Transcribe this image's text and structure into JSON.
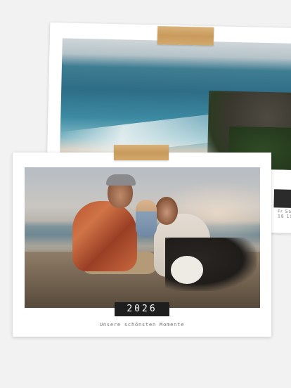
{
  "front": {
    "year": "2026",
    "subtitle": "Unsere schönsten Momente"
  },
  "back": {
    "calendar_days": [
      "Fr",
      "Sa"
    ],
    "calendar_numbers": [
      "18",
      "19"
    ]
  },
  "colors": {
    "background": "#f2f2f2",
    "card": "#ffffff",
    "tape": "#c99a5c",
    "year_badge": "#1e1e1e"
  }
}
